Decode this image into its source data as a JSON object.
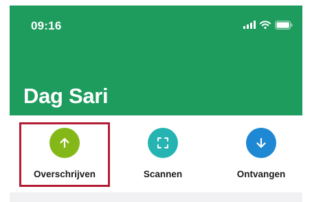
{
  "status_bar": {
    "time": "09:16",
    "icons": [
      "signal-icon",
      "wifi-icon",
      "battery-icon"
    ]
  },
  "header": {
    "title": "Dag Sari",
    "background_color": "#1e9c5e"
  },
  "actions": [
    {
      "label": "Overschrijven",
      "icon": "arrow-up-icon",
      "color": "#84b818",
      "highlighted": true
    },
    {
      "label": "Scannen",
      "icon": "scan-icon",
      "color": "#25b4b2",
      "highlighted": false
    },
    {
      "label": "Ontvangen",
      "icon": "arrow-down-icon",
      "color": "#1e88d4",
      "highlighted": false
    }
  ],
  "highlight_color": "#b31b34"
}
